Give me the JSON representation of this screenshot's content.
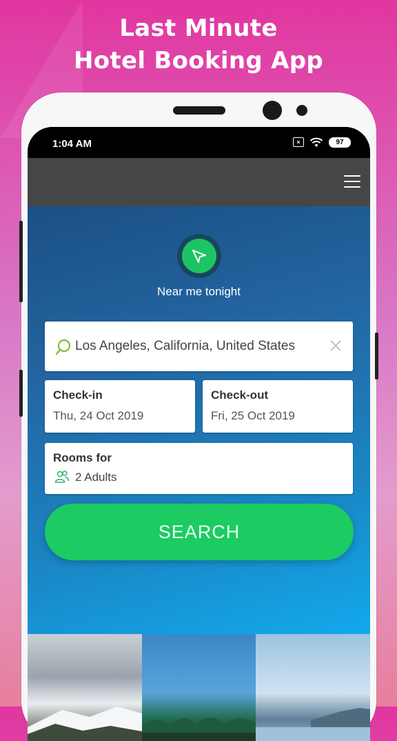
{
  "promo": {
    "line1": "Last Minute",
    "line2": "Hotel Booking App"
  },
  "status_bar": {
    "time": "1:04 AM",
    "battery": "97",
    "icons": [
      "sim-x-icon",
      "wifi-icon",
      "battery-icon"
    ]
  },
  "header": {
    "menu_icon": "hamburger-menu-icon"
  },
  "near_me": {
    "label": "Near me tonight",
    "icon": "navigation-arrow-icon"
  },
  "search": {
    "value": "Los Angeles, California, United States",
    "icon": "search-icon",
    "clear_icon": "close-icon"
  },
  "checkin": {
    "label": "Check-in",
    "value": "Thu, 24 Oct 2019"
  },
  "checkout": {
    "label": "Check-out",
    "value": "Fri, 25 Oct 2019"
  },
  "rooms": {
    "label": "Rooms for",
    "value": "2 Adults",
    "icon": "people-icon"
  },
  "search_button": {
    "label": "SEARCH"
  },
  "colors": {
    "accent_green": "#1ccb62",
    "header_gray": "#464646",
    "promo_pink": "#e1369f"
  }
}
